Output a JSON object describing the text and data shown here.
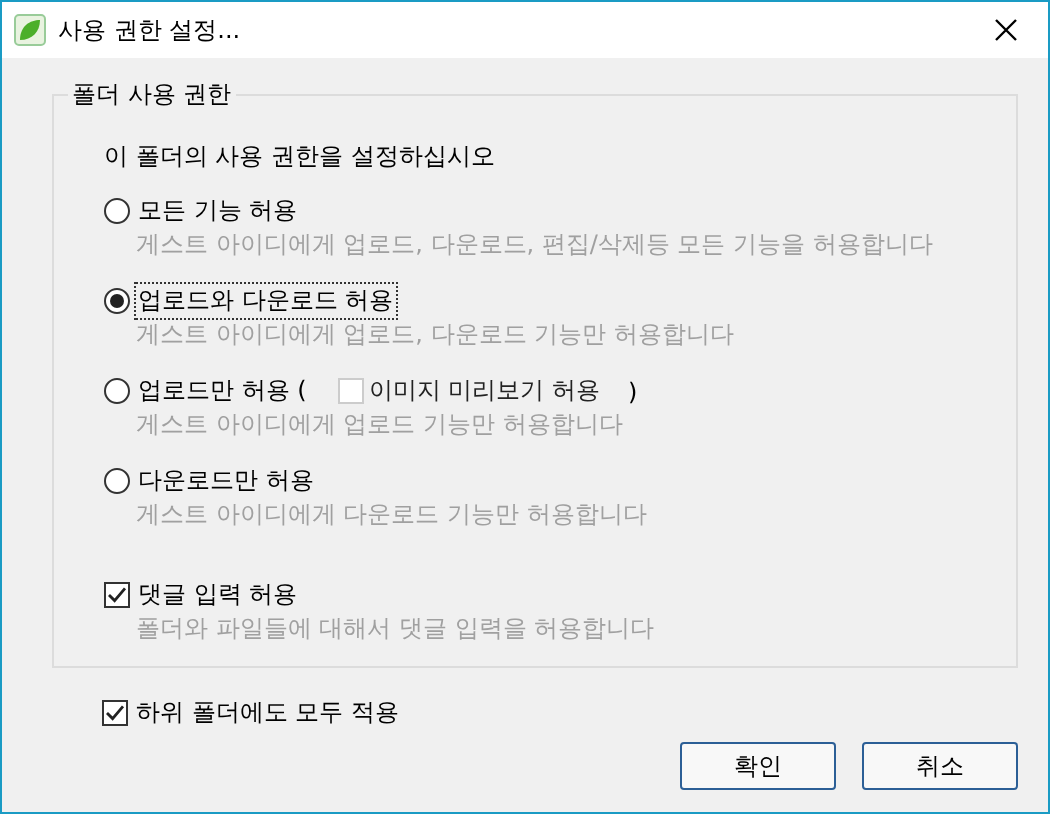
{
  "window": {
    "title": "사용 권한 설정..."
  },
  "group": {
    "title": "폴더 사용 권한",
    "intro": "이 폴더의 사용 권한을 설정하십시오",
    "options": [
      {
        "label": "모든 기능 허용",
        "description": "게스트 아이디에게 업로드, 다운로드, 편집/삭제등 모든  기능을 허용합니다",
        "selected": false
      },
      {
        "label": "업로드와 다운로드 허용",
        "description": "게스트 아이디에게 업로드, 다운로드 기능만 허용합니다",
        "selected": true
      },
      {
        "label": "업로드만 허용 (",
        "inline_checkbox": {
          "label": "이미지 미리보기 허용",
          "checked": false,
          "disabled": true
        },
        "label_end": ")",
        "description": "게스트 아이디에게 업로드 기능만 허용합니다",
        "selected": false
      },
      {
        "label": "다운로드만 허용",
        "description": "게스트 아이디에게 다운로드 기능만 허용합니다",
        "selected": false
      }
    ],
    "comment": {
      "label": "댓글 입력 허용",
      "description": "폴더와 파일들에 대해서 댓글 입력을 허용합니다",
      "checked": true
    }
  },
  "apply_subfolders": {
    "label": "하위 폴더에도 모두 적용",
    "checked": true
  },
  "buttons": [
    "확인",
    "취소"
  ]
}
